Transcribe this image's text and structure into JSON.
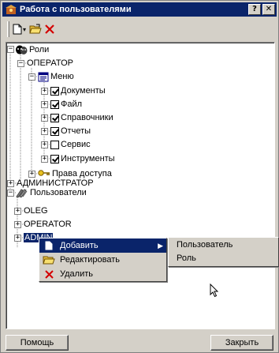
{
  "window": {
    "title": "Работа с пользователями",
    "help_label": "?",
    "close_label": "✕"
  },
  "toolbar": {
    "new_icon": "new-document-icon",
    "dropdown_glyph": "▾",
    "open_icon": "open-folder-icon",
    "delete_icon": "delete-x-icon"
  },
  "tree": {
    "roles": "Роли",
    "operator": "ОПЕРАТОР",
    "menu": "Меню",
    "documents": "Документы",
    "file": "Файл",
    "references": "Справочники",
    "reports": "Отчеты",
    "service": "Сервис",
    "tools": "Инструменты",
    "access_rights": "Права доступа",
    "administrator": "АДМИНИСТРАТОР",
    "users": "Пользователи",
    "user_oleg": "OLEG",
    "user_operator": "OPERATOR",
    "user_admin": "ADMIN"
  },
  "checks": {
    "documents": true,
    "file": true,
    "references": true,
    "reports": true,
    "service": false,
    "tools": true
  },
  "context_menu": {
    "add": "Добавить",
    "edit": "Редактировать",
    "delete": "Удалить",
    "submenu_arrow": "▶"
  },
  "submenu": {
    "user": "Пользователь",
    "role": "Роль"
  },
  "buttons": {
    "help": "Помощь",
    "close": "Закрыть"
  },
  "colors": {
    "title_bar": "#0a246a",
    "face": "#d4d0c8",
    "delete_red": "#d40000"
  }
}
